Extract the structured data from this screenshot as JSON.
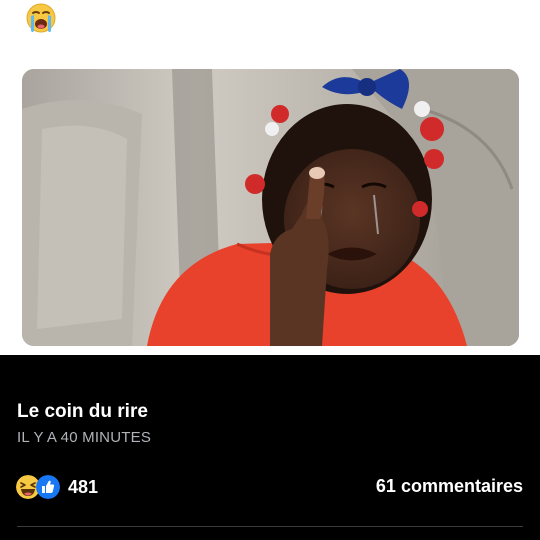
{
  "post": {
    "caption_emoji": "loudly-crying-face",
    "image": {
      "subject": "crying-child-photo"
    }
  },
  "footer": {
    "page_name": "Le coin du rire",
    "timestamp": "IL Y A 40 MINUTES",
    "reactions": {
      "icons": [
        "haha-reaction-icon",
        "like-reaction-icon"
      ],
      "count": "481"
    },
    "comments_label": "61 commentaires"
  },
  "colors": {
    "top_background": "#ffffff",
    "footer_background": "#000000",
    "secondary_text": "#b0b3b8",
    "like_blue": "#1877f2",
    "haha_yellow": "#f7c843",
    "divider": "#3a3b3c"
  }
}
